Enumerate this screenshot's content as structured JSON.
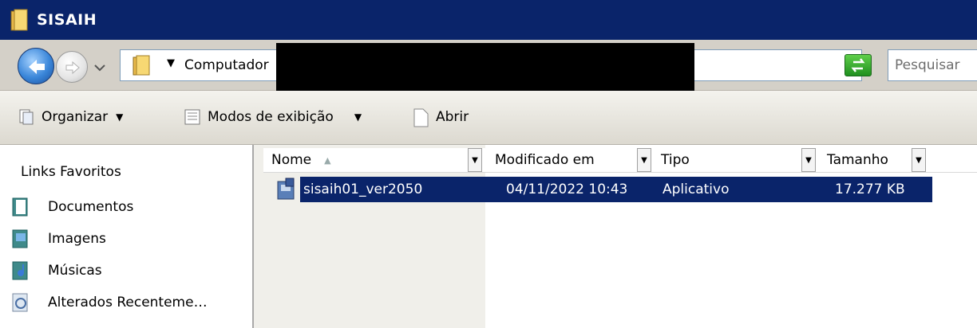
{
  "window": {
    "title": "SISAIH"
  },
  "address": {
    "crumb": "Computador",
    "search_placeholder": "Pesquisar"
  },
  "toolbar": {
    "organize": "Organizar",
    "views": "Modos de exibição",
    "open": "Abrir"
  },
  "sidebar": {
    "title": "Links Favoritos",
    "items": [
      {
        "label": "Documentos",
        "icon": "documents-icon"
      },
      {
        "label": "Imagens",
        "icon": "pictures-icon"
      },
      {
        "label": "Músicas",
        "icon": "music-icon"
      },
      {
        "label": "Alterados Recenteme…",
        "icon": "recent-icon"
      }
    ]
  },
  "columns": [
    "Nome",
    "Modificado em",
    "Tipo",
    "Tamanho"
  ],
  "files": [
    {
      "name": "sisaih01_ver2050",
      "modified": "04/11/2022 10:43",
      "type": "Aplicativo",
      "size": "17.277 KB"
    }
  ],
  "colors": {
    "titlebar": "#0a246a",
    "selection": "#0a246a",
    "chrome": "#d4d0c8"
  }
}
